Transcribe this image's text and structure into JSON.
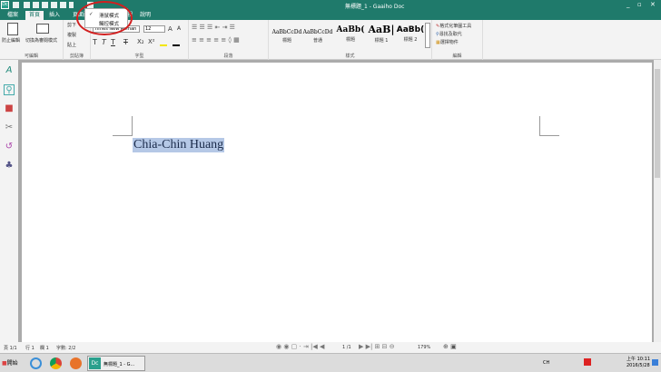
{
  "window": {
    "title": "無標題_1 - Gaaiho Doc",
    "logo": "Dc",
    "minimize": "_",
    "restore": "▫",
    "close": "✕"
  },
  "tabs": [
    "檔案",
    "首頁",
    "插入",
    "頁面配置",
    "檢視",
    "說明"
  ],
  "mode_menu": {
    "items": [
      {
        "label": "滑鼠模式",
        "checked": true,
        "check": "✓"
      },
      {
        "label": "觸控模式",
        "checked": false
      }
    ]
  },
  "ribbon": {
    "editable": {
      "prevent": "防止編輯",
      "switch": "切換為審閱模式",
      "label": "可編輯"
    },
    "clipboard": {
      "cut": "剪下",
      "copy": "複製",
      "paste": "貼上",
      "label": "剪貼簿"
    },
    "font": {
      "name": "Times New Roman",
      "size": "12",
      "label": "字型",
      "buttons": [
        "T",
        "T",
        "T",
        "T",
        "X₂",
        "X²"
      ]
    },
    "paragraph": {
      "label": "段落"
    },
    "styles": {
      "items": [
        {
          "sample": "AaBbCcDd",
          "label": "標題"
        },
        {
          "sample": "AaBbCcDd",
          "label": "普通"
        },
        {
          "sample": "AaBb(",
          "label": "標題"
        },
        {
          "sample": "AaB|",
          "label": "標題 1"
        },
        {
          "sample": "AaBb(",
          "label": "標題 2"
        }
      ],
      "label": "樣式"
    },
    "editing": {
      "format_painter": "格式化筆圖工具",
      "find_replace": "尋找及取代",
      "select": "選擇物件",
      "label": "編輯"
    }
  },
  "document": {
    "text": "Chia-Chin Huang"
  },
  "status": {
    "page": "頁 1/1",
    "line": "行 1",
    "col": "欄 1",
    "words": "字數: 2/2",
    "page_nav": "1 /1",
    "zoom": "179%"
  },
  "taskbar": {
    "start": "開始",
    "app": "無標題_1 - G...",
    "app_logo": "Dc",
    "lang": "CH",
    "time": "上午 10:11",
    "date": "2016/5/28"
  }
}
